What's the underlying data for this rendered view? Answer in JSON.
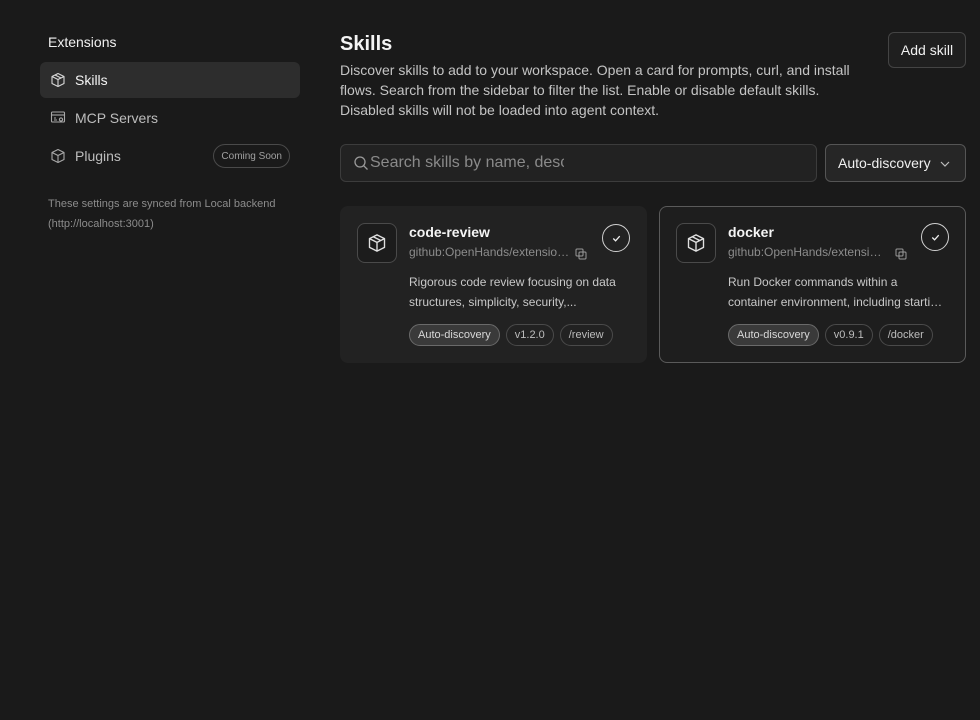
{
  "sidebar": {
    "title": "Extensions",
    "items": [
      {
        "label": "Skills",
        "icon": "box-icon",
        "active": true
      },
      {
        "label": "MCP Servers",
        "icon": "server-icon"
      },
      {
        "label": "Plugins",
        "icon": "package-icon",
        "badge": "Coming Soon"
      }
    ],
    "sync_note_line1": "These settings are synced from Local backend",
    "sync_note_line2": "(http://localhost:3001)"
  },
  "main": {
    "title": "Skills",
    "description": "Discover skills to add to your workspace. Open a card for prompts, curl, and install flows. Search from the sidebar to filter the list. Enable or disable default skills. Disabled skills will not be loaded into agent context.",
    "add_skill_label": "Add skill",
    "search": {
      "placeholder": "Search skills by name, description, or source",
      "value": ""
    },
    "filter": {
      "selected": "Auto-discovery"
    }
  },
  "skills": [
    {
      "name": "code-review",
      "source": "github:OpenHands/extensions/skills/code-review",
      "desc_line1": "Rigorous code review focusing on data",
      "desc_line2": "structures, simplicity, security,...",
      "tags": [
        "Auto-discovery",
        "v1.2.0",
        "/review"
      ],
      "enabled": true
    },
    {
      "name": "docker",
      "source": "github:OpenHands/extensions/skills/docker",
      "desc_line1": "Run Docker commands within a",
      "desc_line2": "container environment, including starting containers",
      "tags": [
        "Auto-discovery",
        "v0.9.1",
        "/docker"
      ],
      "enabled": true
    }
  ],
  "colors": {
    "background": "#1a1a1a",
    "card": "#222222",
    "text": "#e8e8e8"
  }
}
